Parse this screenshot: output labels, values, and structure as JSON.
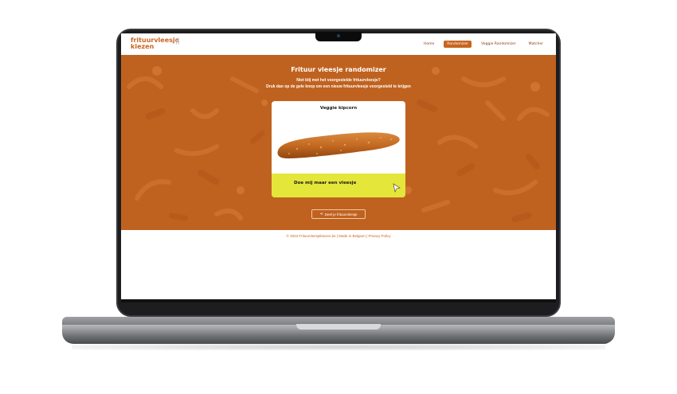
{
  "site": {
    "logo_line1": "frituurvleesje",
    "logo_line2": "kiezen"
  },
  "nav": {
    "items": [
      {
        "label": "Home",
        "active": false
      },
      {
        "label": "Randomizer",
        "active": true
      },
      {
        "label": "Veggie Randomizer",
        "active": false
      },
      {
        "label": "Matcher",
        "active": false
      }
    ]
  },
  "hero": {
    "title": "Frituur vleesje randomizer",
    "subtitle1": "Niet blij met het voorgestelde frituurvleesje?",
    "subtitle2": "Druk dan op de gele knop om een nieuw frituurvleesje voorgesteld te krijgen"
  },
  "card": {
    "product_name": "Veggie kipcorn",
    "button_label": "Doe mij maar een vleesje"
  },
  "share": {
    "label": "Deel je frituurvleesje"
  },
  "footer": {
    "text": "© 2023 Frituurvleesjekiezen.be | Made in Belgium | Privacy Policy"
  },
  "colors": {
    "brand": "#c8651f",
    "hero_bg": "#c0621f",
    "accent_yellow": "#e4e63a"
  }
}
